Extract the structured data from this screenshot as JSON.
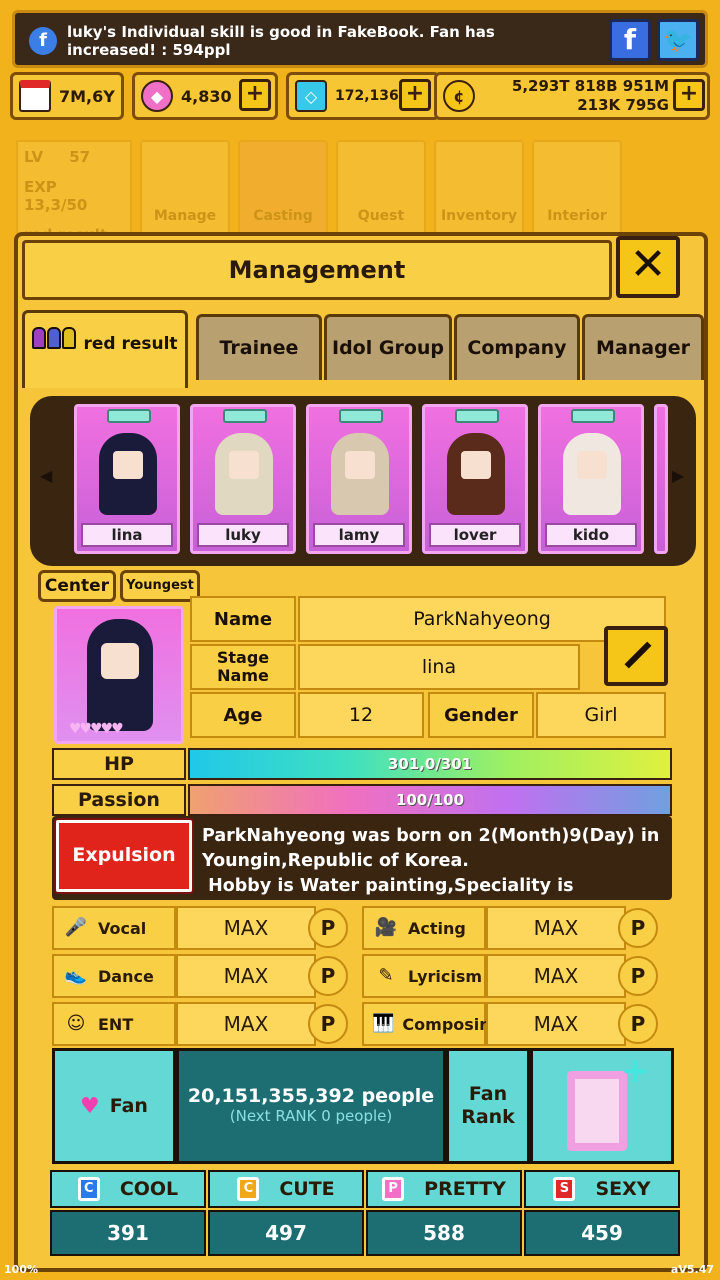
{
  "notice": {
    "text": "luky's Individual skill is good in FakeBook. Fan has increased! : 594ppl",
    "facebook_label": "f",
    "twitter_label": "🐦"
  },
  "resources": {
    "date": "7M,6Y",
    "gems": "4,830",
    "diamonds": "172,136",
    "gold_line1": "5,293T 818B 951M",
    "gold_line2": "213K 795G",
    "plus": "+"
  },
  "background_menu": {
    "lv_label": "LV",
    "lv_value": "57",
    "exp": "EXP 13,3/50",
    "group": "red result",
    "tiles": [
      "Manage",
      "Casting",
      "Quest",
      "Inventory",
      "Interior"
    ]
  },
  "panel": {
    "title": "Management",
    "close": "✕",
    "tabs": [
      "red result",
      "Trainee",
      "Idol Group",
      "Company",
      "Manager"
    ],
    "members": [
      {
        "name": "lina",
        "hair": "#1a1a3a",
        "skin": "#f8e0d0"
      },
      {
        "name": "luky",
        "hair": "#e0d8c0",
        "skin": "#f8e0d0"
      },
      {
        "name": "lamy",
        "hair": "#d8c8b0",
        "skin": "#f8e0d0"
      },
      {
        "name": "lover",
        "hair": "#5a2a1a",
        "skin": "#f8e0d0"
      },
      {
        "name": "kido",
        "hair": "#f0e8e0",
        "skin": "#f8e0d0"
      }
    ]
  },
  "profile": {
    "badge_center": "Center",
    "badge_youngest": "Youngest",
    "hearts": "♥♥♥♥♥",
    "name_label": "Name",
    "name_value": "ParkNahyeong",
    "stage_label": "Stage Name",
    "stage_value": "lina",
    "age_label": "Age",
    "age_value": "12",
    "gender_label": "Gender",
    "gender_value": "Girl",
    "hp_label": "HP",
    "hp_value": "301,0/301",
    "hp_fraction": 1.0,
    "passion_label": "Passion",
    "passion_value": "100/100",
    "passion_fraction": 1.0,
    "expulsion": "Expulsion",
    "bio": "ParkNahyeong was born on 2(Month)9(Day) in Youngin,Republic of Korea.\n Hobby is Water painting,Speciality is Cosmetic"
  },
  "skills": [
    {
      "name": "Vocal",
      "value": "MAX",
      "icon": "mic-icon",
      "glyph": "🎤"
    },
    {
      "name": "Acting",
      "value": "MAX",
      "icon": "camera-icon",
      "glyph": "🎥"
    },
    {
      "name": "Dance",
      "value": "MAX",
      "icon": "shoe-icon",
      "glyph": "👟"
    },
    {
      "name": "Lyricism",
      "value": "MAX",
      "icon": "pen-icon",
      "glyph": "✎"
    },
    {
      "name": "ENT",
      "value": "MAX",
      "icon": "smile-icon",
      "glyph": "☺"
    },
    {
      "name": "Composing",
      "value": "MAX",
      "icon": "piano-icon",
      "glyph": "🎹"
    }
  ],
  "p_label": "P",
  "fan": {
    "label": "Fan",
    "count": "20,151,355,392 people",
    "next": "(Next RANK 0 people)",
    "rank_label": "Fan Rank"
  },
  "stats": [
    {
      "name": "COOL",
      "value": "391",
      "letter": "C",
      "color": "#2a7ae8"
    },
    {
      "name": "CUTE",
      "value": "497",
      "letter": "C",
      "color": "#f0a818"
    },
    {
      "name": "PRETTY",
      "value": "588",
      "letter": "P",
      "color": "#f070c8"
    },
    {
      "name": "SEXY",
      "value": "459",
      "letter": "S",
      "color": "#e02828"
    }
  ],
  "footer": {
    "zoom": "100%",
    "version": "aV5.47"
  }
}
